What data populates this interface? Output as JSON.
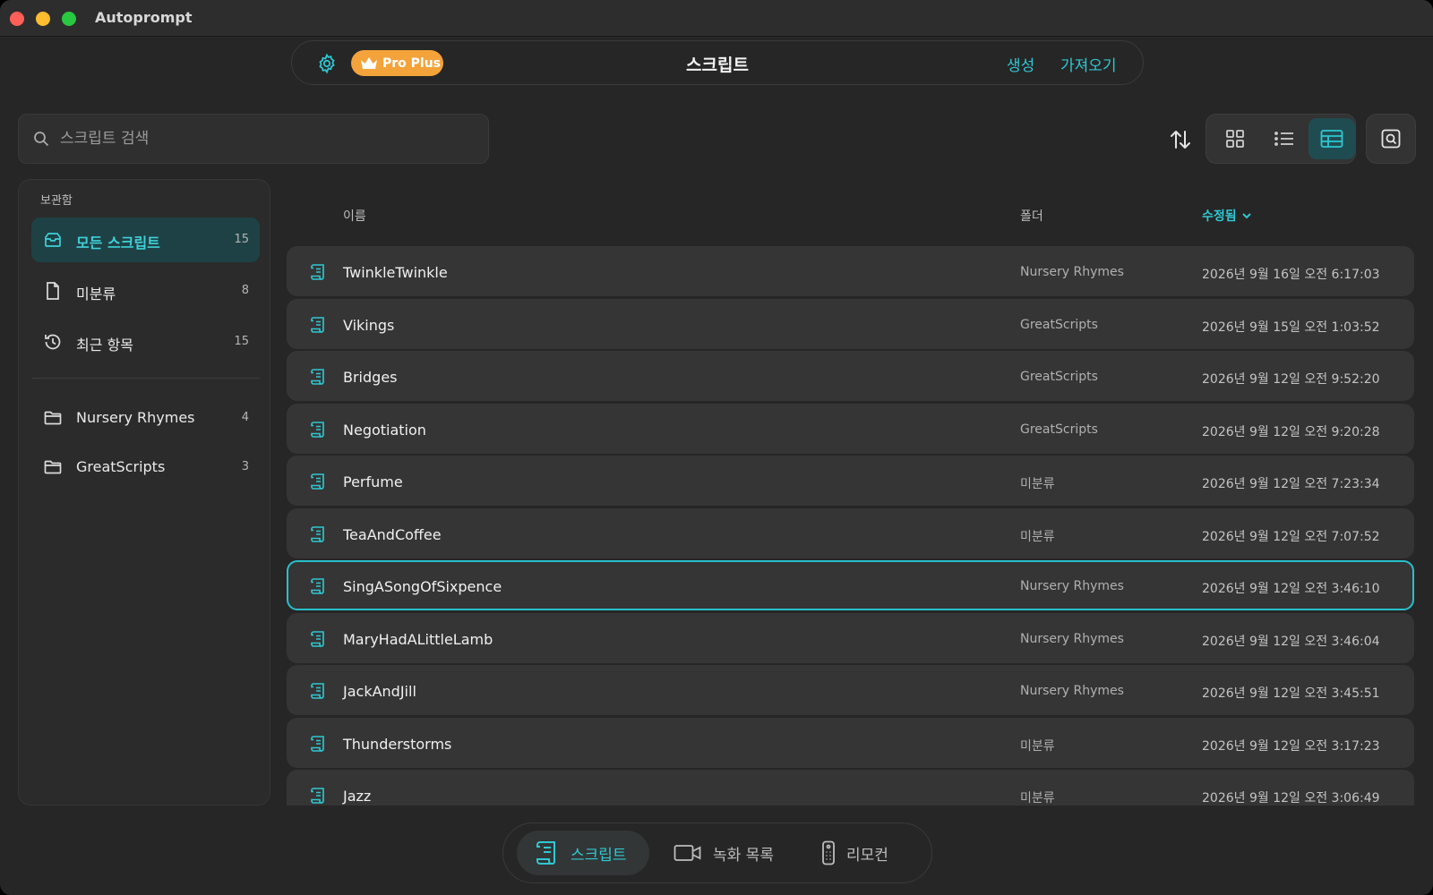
{
  "window": {
    "title": "Autoprompt"
  },
  "topbar": {
    "settings_icon": "gear-icon",
    "badge": "Pro Plus",
    "title": "스크립트",
    "create": "생성",
    "import": "가져오기",
    "accent": "#2fc8d2",
    "badge_color": "#f3a33a"
  },
  "search": {
    "placeholder": "스크립트 검색",
    "value": ""
  },
  "sidebar": {
    "heading": "보관함",
    "library": [
      {
        "label": "모든 스크립트",
        "count": "15",
        "icon": "all-scripts-icon",
        "active": true
      },
      {
        "label": "미분류",
        "count": "8",
        "icon": "document-icon",
        "active": false
      },
      {
        "label": "최근 항목",
        "count": "15",
        "icon": "history-icon",
        "active": false
      }
    ],
    "folders": [
      {
        "label": "Nursery Rhymes",
        "count": "4",
        "icon": "folder-icon"
      },
      {
        "label": "GreatScripts",
        "count": "3",
        "icon": "folder-icon"
      }
    ]
  },
  "table": {
    "columns": {
      "name": "이름",
      "folder": "폴더",
      "modified": "수정됨"
    },
    "sort": {
      "column": "modified",
      "direction": "descending"
    },
    "rows": [
      {
        "name": "TwinkleTwinkle",
        "folder": "Nursery Rhymes",
        "modified": "2026년 9월 16일 오전 6:17:03"
      },
      {
        "name": "Vikings",
        "folder": "GreatScripts",
        "modified": "2026년 9월 15일 오전 1:03:52"
      },
      {
        "name": "Bridges",
        "folder": "GreatScripts",
        "modified": "2026년 9월 12일 오전 9:52:20"
      },
      {
        "name": "Negotiation",
        "folder": "GreatScripts",
        "modified": "2026년 9월 12일 오전 9:20:28"
      },
      {
        "name": "Perfume",
        "folder": "미분류",
        "modified": "2026년 9월 12일 오전 7:23:34"
      },
      {
        "name": "TeaAndCoffee",
        "folder": "미분류",
        "modified": "2026년 9월 12일 오전 7:07:52"
      },
      {
        "name": "SingASongOfSixpence",
        "folder": "Nursery Rhymes",
        "modified": "2026년 9월 12일 오전 3:46:10",
        "selected": true
      },
      {
        "name": "MaryHadALittleLamb",
        "folder": "Nursery Rhymes",
        "modified": "2026년 9월 12일 오전 3:46:04"
      },
      {
        "name": "JackAndJill",
        "folder": "Nursery Rhymes",
        "modified": "2026년 9월 12일 오전 3:45:51"
      },
      {
        "name": "Thunderstorms",
        "folder": "미분류",
        "modified": "2026년 9월 12일 오전 3:17:23"
      },
      {
        "name": "Jazz",
        "folder": "미분류",
        "modified": "2026년 9월 12일 오전 3:06:49"
      }
    ]
  },
  "view_modes": {
    "active": "table",
    "options": [
      "grid",
      "list",
      "table"
    ]
  },
  "bottom_nav": [
    {
      "label": "스크립트",
      "icon": "script-icon",
      "active": true
    },
    {
      "label": "녹화 목록",
      "icon": "video-camera-icon",
      "active": false
    },
    {
      "label": "리모컨",
      "icon": "remote-icon",
      "active": false
    }
  ]
}
